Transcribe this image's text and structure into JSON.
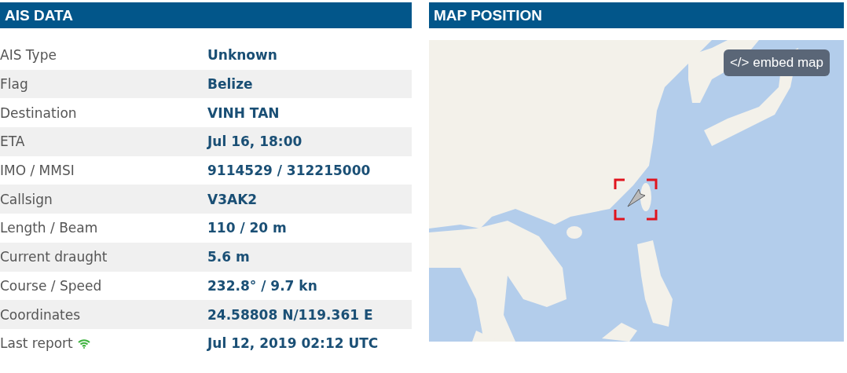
{
  "ais_panel": {
    "title": "AIS DATA",
    "rows": [
      {
        "label": "AIS Type",
        "value": "Unknown"
      },
      {
        "label": "Flag",
        "value": "Belize"
      },
      {
        "label": "Destination",
        "value": "VINH TAN"
      },
      {
        "label": "ETA",
        "value": "Jul 16, 18:00"
      },
      {
        "label": "IMO / MMSI",
        "value": "9114529 / 312215000"
      },
      {
        "label": "Callsign",
        "value": "V3AK2"
      },
      {
        "label": "Length / Beam",
        "value": "110 / 20 m"
      },
      {
        "label": "Current draught",
        "value": "5.6 m"
      },
      {
        "label": "Course / Speed",
        "value": "232.8° / 9.7 kn"
      },
      {
        "label": "Coordinates",
        "value": "24.58808 N/119.361 E"
      },
      {
        "label": "Last report",
        "value": "Jul 12, 2019 02:12 UTC",
        "kind": "signal"
      }
    ]
  },
  "map_panel": {
    "title": "MAP POSITION",
    "embed_button": "</> embed map"
  }
}
